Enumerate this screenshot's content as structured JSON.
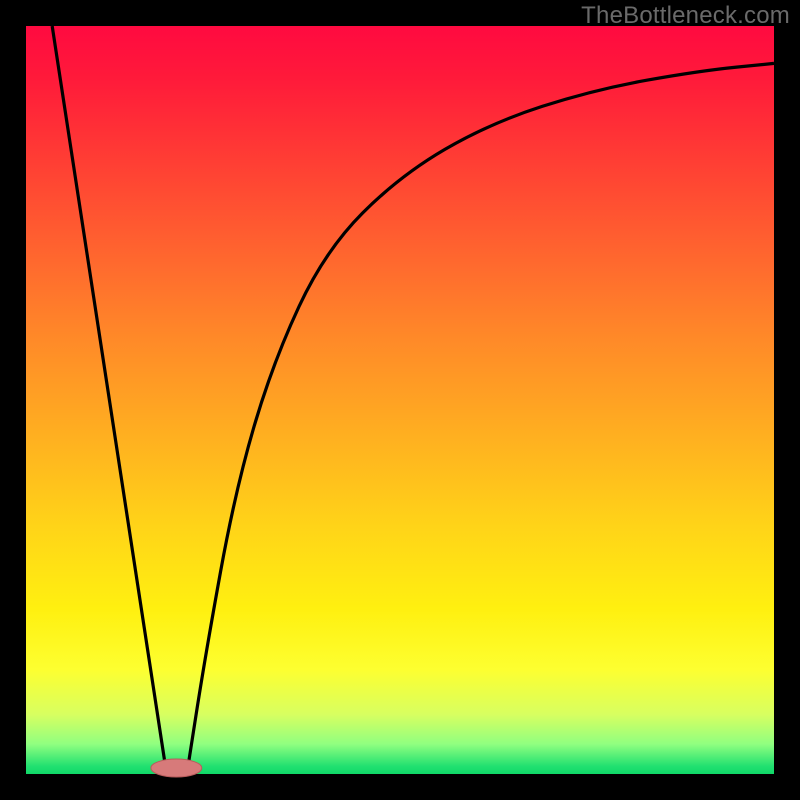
{
  "watermark": "TheBottleneck.com",
  "colors": {
    "frame": "#000000",
    "curve_stroke": "#000000",
    "marker_fill": "#d77a7a",
    "marker_stroke": "#b85c5c"
  },
  "chart_data": {
    "type": "line",
    "title": "",
    "xlabel": "",
    "ylabel": "",
    "xlim": [
      0,
      100
    ],
    "ylim": [
      0,
      100
    ],
    "grid": false,
    "series": [
      {
        "name": "left-descent",
        "x": [
          3.5,
          18.8
        ],
        "y": [
          100,
          0
        ]
      },
      {
        "name": "right-curve",
        "x": [
          21.5,
          24,
          28,
          33,
          40,
          50,
          62,
          76,
          90,
          100
        ],
        "y": [
          0,
          16,
          38,
          55,
          70,
          80,
          87,
          91.5,
          94,
          95
        ]
      }
    ],
    "annotations": [
      {
        "name": "bottleneck-marker",
        "shape": "pill",
        "x": 20.1,
        "y": 0.8,
        "rx": 3.4,
        "ry": 1.2
      }
    ]
  }
}
